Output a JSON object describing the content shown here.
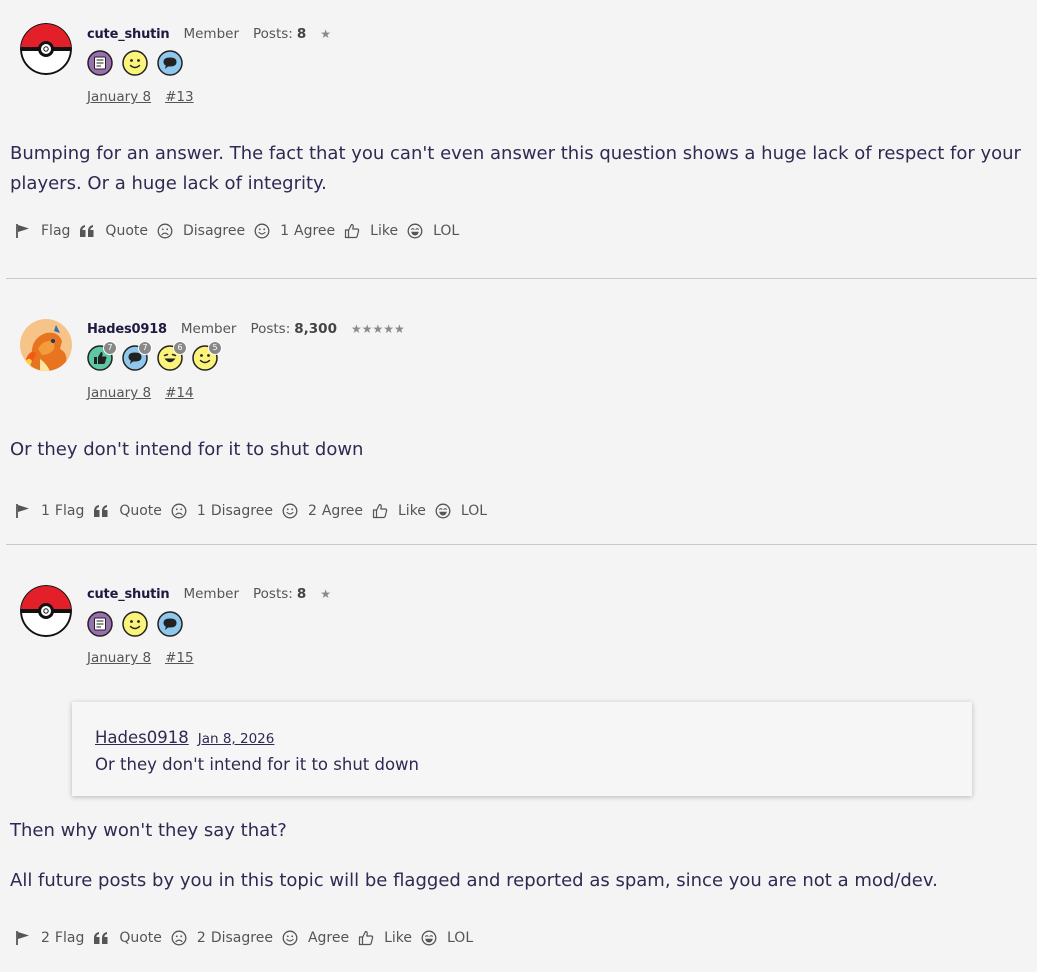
{
  "posts": [
    {
      "username": "cute_shutin",
      "role": "Member",
      "posts_label": "Posts:",
      "posts_count": "8",
      "stars": "★",
      "date": "January 8",
      "permalink": "#13",
      "badges": [
        {
          "icon": "notebook-badge-icon",
          "count": ""
        },
        {
          "icon": "smiley-badge-icon",
          "count": ""
        },
        {
          "icon": "speech-bubble-badge-icon",
          "count": ""
        }
      ],
      "quote": null,
      "paragraphs": [
        "Bumping for an answer. The fact that you can't even answer this question shows a huge lack of respect for your players. Or a huge lack of integrity."
      ],
      "actions": {
        "flag": {
          "count": "",
          "label": "Flag"
        },
        "quote": {
          "label": "Quote"
        },
        "disagree": {
          "count": "",
          "label": "Disagree"
        },
        "agree": {
          "count": "1",
          "label": "Agree"
        },
        "like": {
          "count": "",
          "label": "Like"
        },
        "lol": {
          "count": "",
          "label": "LOL"
        }
      }
    },
    {
      "username": "Hades0918",
      "role": "Member",
      "posts_label": "Posts:",
      "posts_count": "8,300",
      "stars": "★★★★★",
      "date": "January 8",
      "permalink": "#14",
      "badges": [
        {
          "icon": "thumbs-up-badge-icon",
          "count": "7"
        },
        {
          "icon": "speech-bubble-badge-icon",
          "count": "7"
        },
        {
          "icon": "laughing-badge-icon",
          "count": "6"
        },
        {
          "icon": "smiley-badge-icon",
          "count": "5"
        }
      ],
      "quote": null,
      "paragraphs": [
        "Or they don't intend for it to shut down"
      ],
      "actions": {
        "flag": {
          "count": "1",
          "label": "Flag"
        },
        "quote": {
          "label": "Quote"
        },
        "disagree": {
          "count": "1",
          "label": "Disagree"
        },
        "agree": {
          "count": "2",
          "label": "Agree"
        },
        "like": {
          "count": "",
          "label": "Like"
        },
        "lol": {
          "count": "",
          "label": "LOL"
        }
      }
    },
    {
      "username": "cute_shutin",
      "role": "Member",
      "posts_label": "Posts:",
      "posts_count": "8",
      "stars": "★",
      "date": "January 8",
      "permalink": "#15",
      "badges": [
        {
          "icon": "notebook-badge-icon",
          "count": ""
        },
        {
          "icon": "smiley-badge-icon",
          "count": ""
        },
        {
          "icon": "speech-bubble-badge-icon",
          "count": ""
        }
      ],
      "quote": {
        "author": "Hades0918",
        "date": "Jan 8, 2026",
        "text": "Or they don't intend for it to shut down"
      },
      "paragraphs": [
        "Then why won't they say that?",
        "All future posts by you in this topic will be flagged and reported as spam, since you are not a mod/dev."
      ],
      "actions": {
        "flag": {
          "count": "2",
          "label": "Flag"
        },
        "quote": {
          "label": "Quote"
        },
        "disagree": {
          "count": "2",
          "label": "Disagree"
        },
        "agree": {
          "count": "",
          "label": "Agree"
        },
        "like": {
          "count": "",
          "label": "Like"
        },
        "lol": {
          "count": "",
          "label": "LOL"
        }
      }
    }
  ],
  "colors": {
    "background": "#f4f4f4",
    "text": "#2e2a52",
    "muted": "#555555",
    "pokeball_red": "#e3202a",
    "divider": "#c9c9c9"
  }
}
